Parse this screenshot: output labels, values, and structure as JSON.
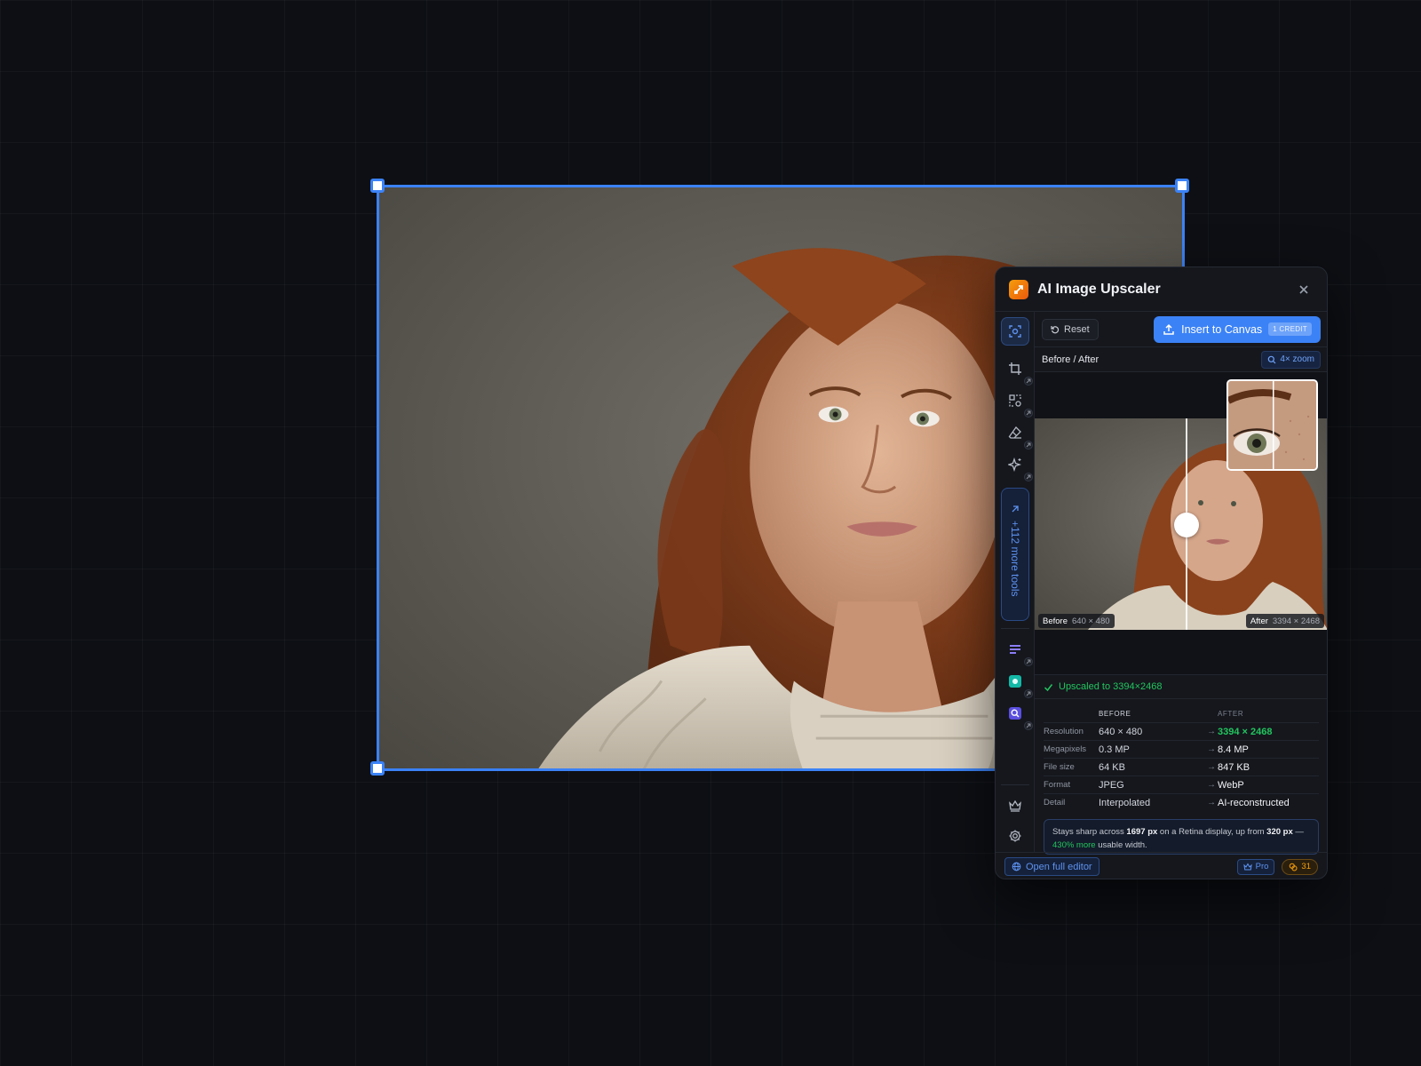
{
  "canvas": {
    "photo_icon": "portrait-photo"
  },
  "panel": {
    "title": "AI Image Upscaler",
    "logo_icon": "upscale-logo-icon",
    "accent": "#3b82f6",
    "success": "#22c55e",
    "rail": {
      "tools": [
        "upscale-icon",
        "crop-icon",
        "background-remove-icon",
        "eraser-icon",
        "sparkle-icon"
      ],
      "more_tools_label": "+112 more tools",
      "apps": [
        "text-app-icon",
        "green-app-icon",
        "search-app-icon"
      ],
      "bottom": [
        "crown-icon",
        "gear-icon"
      ]
    },
    "toolbar": {
      "reset_label": "Reset",
      "insert_label": "Insert to Canvas",
      "credit_badge": "1 CREDIT"
    },
    "compare": {
      "label": "Before / After",
      "zoom_label": "4× zoom"
    },
    "preview": {
      "before_tag": "Before",
      "before_dims": "640 × 480",
      "after_tag": "After",
      "after_dims": "3394 × 2468"
    },
    "status": "Upscaled to 3394×2468",
    "stats": {
      "head_before": "BEFORE",
      "head_after": "AFTER",
      "rows": [
        {
          "label": "Resolution",
          "before": "640 × 480",
          "after": "3394 × 2468"
        },
        {
          "label": "Megapixels",
          "before": "0.3 MP",
          "after": "8.4 MP"
        },
        {
          "label": "File size",
          "before": "64 KB",
          "after": "847 KB"
        },
        {
          "label": "Format",
          "before": "JPEG",
          "after": "WebP"
        },
        {
          "label": "Detail",
          "before": "Interpolated",
          "after": "AI-reconstructed"
        }
      ]
    },
    "note": {
      "t1": "Stays sharp across ",
      "b1": "1697 px",
      "t2": " on a Retina display, up from ",
      "b2": "320 px",
      "t3": " — ",
      "g1": "430% more",
      "t4": " usable width."
    },
    "footer": {
      "open_editor": "Open full editor",
      "pro": "Pro",
      "credits": "31"
    }
  }
}
